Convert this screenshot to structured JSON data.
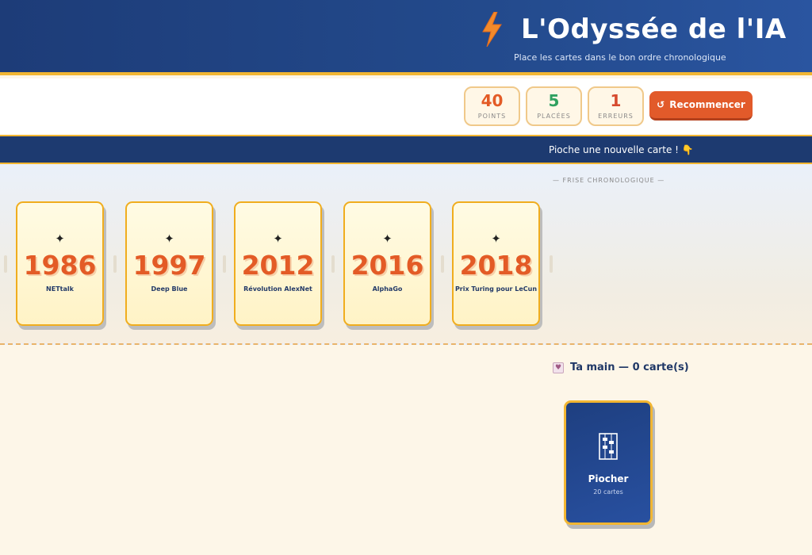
{
  "header": {
    "title": "L'Odyssée de l'IA",
    "subtitle": "Place les cartes dans le bon ordre chronologique"
  },
  "stats": {
    "points": {
      "value": "40",
      "label": "POINTS",
      "color": "#e35b26"
    },
    "placed": {
      "value": "5",
      "label": "PLACÉES",
      "color": "#2fa160"
    },
    "errors": {
      "value": "1",
      "label": "ERREURS",
      "color": "#d64a2e"
    }
  },
  "restart": {
    "icon": "↺",
    "label": "Recommencer"
  },
  "message": {
    "text": "Pioche une nouvelle carte ! 👇"
  },
  "timeline": {
    "label": "— FRISE CHRONOLOGIQUE —",
    "cards": [
      {
        "year": "1986",
        "event": "NETtalk"
      },
      {
        "year": "1997",
        "event": "Deep Blue"
      },
      {
        "year": "2012",
        "event": "Révolution AlexNet"
      },
      {
        "year": "2016",
        "event": "AlphaGo"
      },
      {
        "year": "2018",
        "event": "Prix Turing pour LeCun"
      }
    ]
  },
  "hand": {
    "title": "Ta main — 0 carte(s)"
  },
  "deck": {
    "label": "Piocher",
    "count": "20 cartes"
  },
  "icons": {
    "star": "✦",
    "title": "lightning-bolt-icon",
    "hand": "cards-icon",
    "deck": "abacus-icon"
  },
  "colors": {
    "accent": "#f2b632",
    "header": "#1d3c78",
    "restart": "#e25a2a",
    "year": "#e35b26"
  }
}
